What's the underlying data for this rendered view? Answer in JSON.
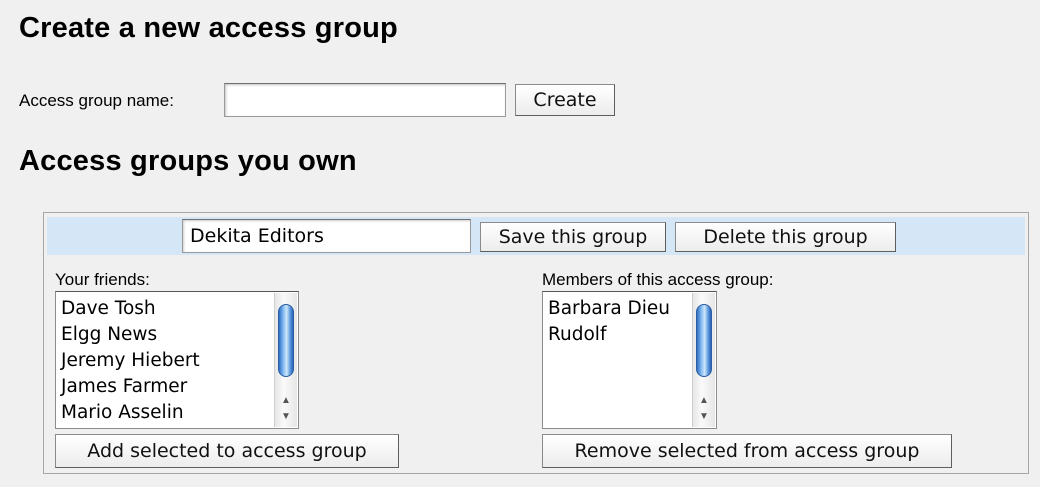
{
  "create_section": {
    "title": "Create a new access group",
    "name_label": "Access group name:",
    "name_value": "",
    "create_label": "Create"
  },
  "owned_section": {
    "title": "Access groups you own",
    "group": {
      "name_value": "Dekita Editors",
      "save_label": "Save this group",
      "delete_label": "Delete this group",
      "friends_label": "Your friends:",
      "friends": [
        "Dave Tosh",
        "Elgg News",
        "Jeremy Hiebert",
        "James Farmer",
        "Mario Asselin"
      ],
      "members_label": "Members of this access group:",
      "members": [
        "Barbara Dieu",
        "Rudolf"
      ],
      "add_label": "Add selected to access group",
      "remove_label": "Remove selected from access group"
    }
  },
  "icons": {
    "scroll_up": "▲",
    "scroll_down": "▼"
  }
}
